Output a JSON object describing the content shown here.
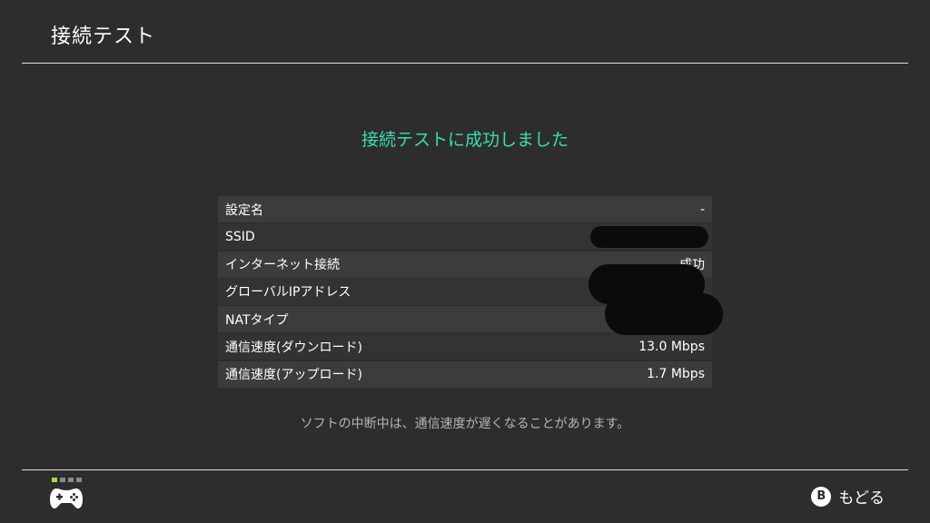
{
  "header": {
    "title": "接続テスト"
  },
  "result": {
    "message": "接続テストに成功しました",
    "color": "#3ddcb1"
  },
  "info_rows": [
    {
      "label": "設定名",
      "value": "-"
    },
    {
      "label": "SSID",
      "value": "",
      "redacted": true
    },
    {
      "label": "インターネット接続",
      "value": "成功"
    },
    {
      "label": "グローバルIPアドレス",
      "value": "",
      "redacted": true
    },
    {
      "label": "NATタイプ",
      "value": "",
      "redacted": true
    },
    {
      "label": "通信速度(ダウンロード)",
      "value": "13.0 Mbps"
    },
    {
      "label": "通信速度(アップロード)",
      "value": "1.7 Mbps"
    }
  ],
  "note": "ソフトの中断中は、通信速度が遅くなることがあります。",
  "footer": {
    "controller_icon": "controller-icon",
    "player_indicator": {
      "active": 1,
      "total": 4
    },
    "back_button": {
      "key": "B",
      "label": "もどる"
    }
  }
}
